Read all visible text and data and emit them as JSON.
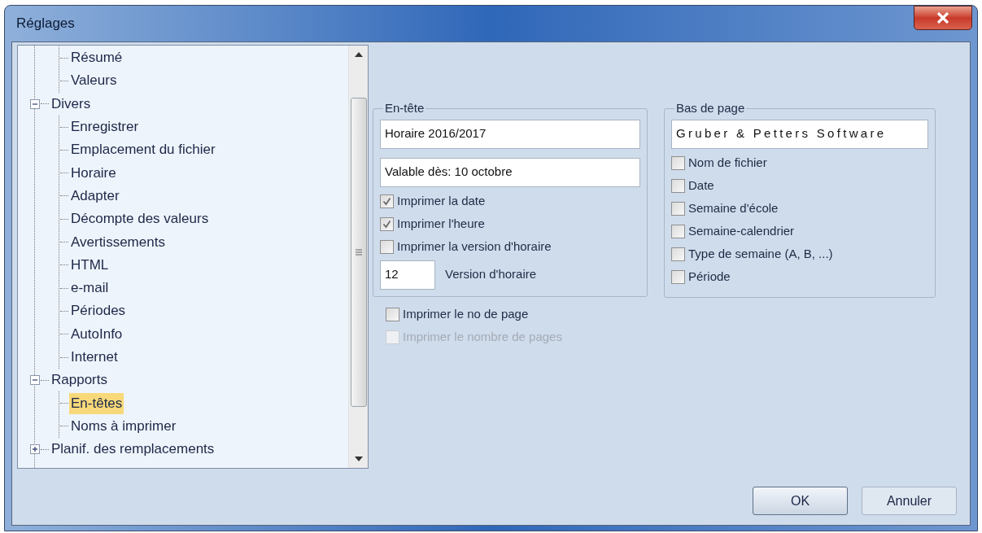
{
  "window": {
    "title": "Réglages"
  },
  "tree": [
    {
      "children": [
        {
          "label": "Résumé",
          "selected": false
        },
        {
          "label": "Valeurs",
          "selected": false
        }
      ]
    },
    {
      "label": "Divers",
      "expanded": true,
      "selected": false,
      "children": [
        {
          "label": "Enregistrer",
          "selected": false
        },
        {
          "label": "Emplacement du fichier",
          "selected": false
        },
        {
          "label": "Horaire",
          "selected": false
        },
        {
          "label": "Adapter",
          "selected": false
        },
        {
          "label": "Décompte des valeurs",
          "selected": false
        },
        {
          "label": "Avertissements",
          "selected": false
        },
        {
          "label": "HTML",
          "selected": false
        },
        {
          "label": "e-mail",
          "selected": false
        },
        {
          "label": "Périodes",
          "selected": false
        },
        {
          "label": "AutoInfo",
          "selected": false
        },
        {
          "label": "Internet",
          "selected": false
        }
      ]
    },
    {
      "label": "Rapports",
      "expanded": true,
      "selected": false,
      "children": [
        {
          "label": "En-têtes",
          "selected": true
        },
        {
          "label": "Noms à imprimer",
          "selected": false
        }
      ]
    },
    {
      "label": "Planif. des remplacements",
      "expanded": false,
      "selected": false
    }
  ],
  "header_group": {
    "legend": "En-tête",
    "fields": [
      {
        "value": "Horaire 2016/2017"
      },
      {
        "value": "Valable dès: 10 octobre"
      }
    ],
    "checkboxes": [
      {
        "label": "Imprimer la date",
        "checked": true
      },
      {
        "label": "Imprimer l'heure",
        "checked": true
      },
      {
        "label": "Imprimer la version d'horaire",
        "checked": false
      }
    ],
    "version": {
      "value": "12",
      "label": "Version d'horaire"
    }
  },
  "page_checkboxes": [
    {
      "label": "Imprimer le no de page",
      "checked": false,
      "disabled": false
    },
    {
      "label": "Imprimer le nombre de pages",
      "checked": false,
      "disabled": true
    }
  ],
  "footer_group": {
    "legend": "Bas de page",
    "field": {
      "value": "Gruber & Petters Software"
    },
    "checkboxes": [
      {
        "label": "Nom de fichier",
        "checked": false
      },
      {
        "label": "Date",
        "checked": false
      },
      {
        "label": "Semaine d'école",
        "checked": false
      },
      {
        "label": "Semaine-calendrier",
        "checked": false
      },
      {
        "label": "Type de semaine (A, B, ...)",
        "checked": false
      },
      {
        "label": "Période",
        "checked": false
      }
    ]
  },
  "buttons": [
    {
      "label": "OK",
      "default": true
    },
    {
      "label": "Annuler",
      "default": false
    }
  ]
}
